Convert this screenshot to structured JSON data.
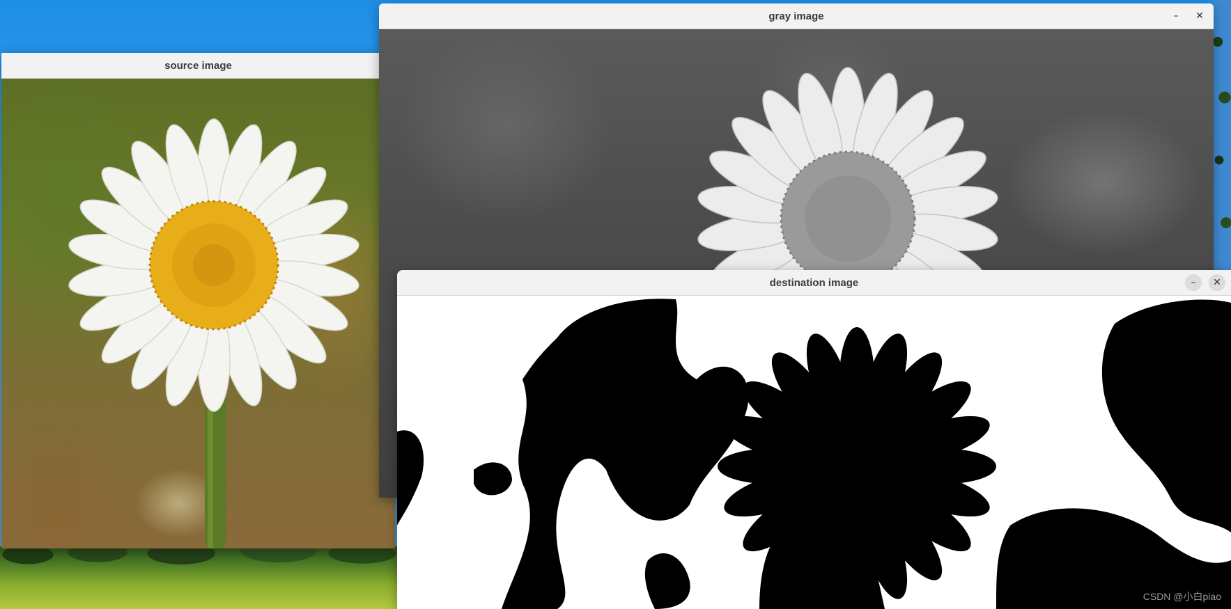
{
  "windows": {
    "source": {
      "title": "source image"
    },
    "gray": {
      "title": "gray image",
      "minimize_glyph": "–",
      "close_glyph": "✕"
    },
    "destination": {
      "title": "destination image",
      "minimize_glyph": "–",
      "close_glyph": "✕"
    }
  },
  "watermark": "CSDN @小白piao",
  "colors": {
    "titlebar": "#f2f2f2",
    "title_text": "#3c3c3c",
    "petal": "#f4f4f0",
    "flower_center": "#e8ae1a",
    "stem": "#5b7a26"
  },
  "icons": {
    "minimize": "minimize-icon",
    "close": "close-icon"
  }
}
